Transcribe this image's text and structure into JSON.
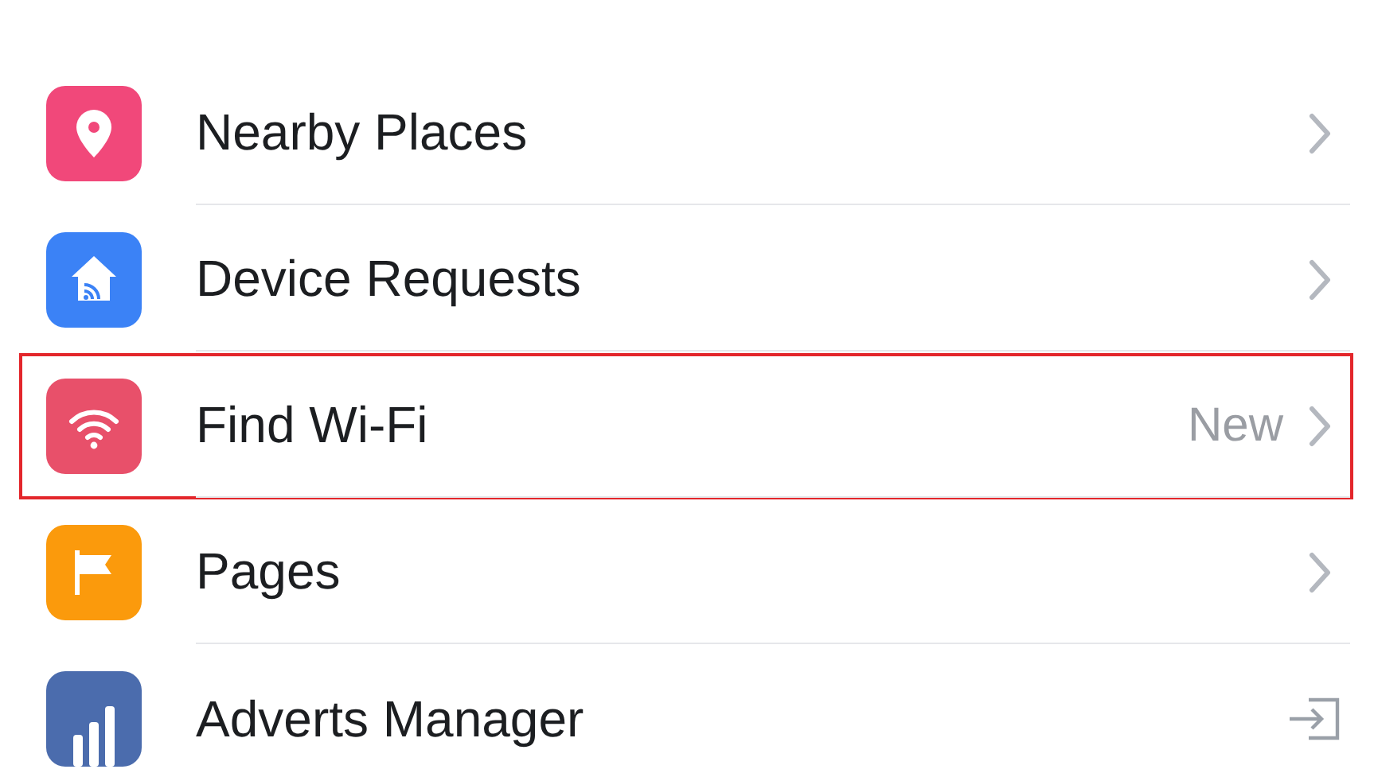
{
  "menu_items": [
    {
      "label": "Nearby Places",
      "color": "#f1487a",
      "kind": "chevron",
      "highlighted": false
    },
    {
      "label": "Device Requests",
      "color": "#3b82f6",
      "kind": "chevron",
      "highlighted": false
    },
    {
      "label": "Find Wi-Fi",
      "color": "#e8506a",
      "kind": "chevron",
      "badge": "New",
      "highlighted": true
    },
    {
      "label": "Pages",
      "color": "#fb9a0c",
      "kind": "chevron",
      "highlighted": false
    },
    {
      "label": "Adverts Manager",
      "color": "#4b6cad",
      "kind": "exit",
      "highlighted": false
    }
  ]
}
